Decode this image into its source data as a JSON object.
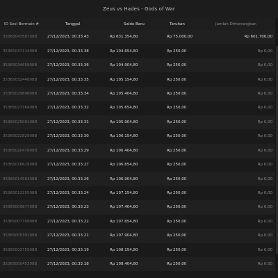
{
  "window": {
    "title": "Zeus vs Hades - Gods of War"
  },
  "table": {
    "headers": {
      "id": "ID Sesi Bermain #",
      "date": "Tanggal",
      "saldo": "Saldo Baru",
      "bet": "Taruhan",
      "win": "Jumlah Dimenangkan"
    },
    "rows": [
      {
        "id": "3536504758708B",
        "date": "27/12/2023, 00.33.43",
        "saldo": "Rp 631.354,80",
        "bet": "Rp 75.000,00",
        "win": "Rp 601.700,00",
        "win_positive": true
      },
      {
        "id": "3536503711408B",
        "date": "27/12/2023, 00.33.38",
        "saldo": "Rp 104.654,80",
        "bet": "Rp 250,00",
        "win": "Rp 0,00",
        "win_positive": false
      },
      {
        "id": "3536503465908B",
        "date": "27/12/2023, 00.33.36",
        "saldo": "Rp 104.904,80",
        "bet": "Rp 250,00",
        "win": "Rp 0,00",
        "win_positive": false
      },
      {
        "id": "3536503244808B",
        "date": "27/12/2023, 00.33.35",
        "saldo": "Rp 105.154,80",
        "bet": "Rp 250,00",
        "win": "Rp 0,00",
        "win_positive": false
      },
      {
        "id": "3536502989608B",
        "date": "27/12/2023, 00.33.34",
        "saldo": "Rp 105.404,80",
        "bet": "Rp 250,00",
        "win": "Rp 0,00",
        "win_positive": false
      },
      {
        "id": "3536502736408B",
        "date": "27/12/2023, 00.33.32",
        "saldo": "Rp 105.654,80",
        "bet": "Rp 250,00",
        "win": "Rp 0,00",
        "win_positive": false
      },
      {
        "id": "3536502509108B",
        "date": "27/12/2023, 00.33.31",
        "saldo": "Rp 105.904,80",
        "bet": "Rp 250,00",
        "win": "Rp 0,00",
        "win_positive": false
      },
      {
        "id": "3536502282908B",
        "date": "27/12/2023, 00.33.30",
        "saldo": "Rp 106.154,80",
        "bet": "Rp 250,00",
        "win": "Rp 0,00",
        "win_positive": false
      },
      {
        "id": "3536502047808B",
        "date": "27/12/2023, 00.33.29",
        "saldo": "Rp 106.404,80",
        "bet": "Rp 250,00",
        "win": "Rp 0,00",
        "win_positive": false
      },
      {
        "id": "3536501662908B",
        "date": "27/12/2023, 00.33.27",
        "saldo": "Rp 106.654,80",
        "bet": "Rp 250,00",
        "win": "Rp 0,00",
        "win_positive": false
      },
      {
        "id": "3536501456308B",
        "date": "27/12/2023, 00.33.26",
        "saldo": "Rp 106.904,80",
        "bet": "Rp 250,00",
        "win": "Rp 0,00",
        "win_positive": false
      },
      {
        "id": "3536501225508B",
        "date": "27/12/2023, 00.33.24",
        "saldo": "Rp 107.154,80",
        "bet": "Rp 250,00",
        "win": "Rp 0,00",
        "win_positive": false
      },
      {
        "id": "3536500987708B",
        "date": "27/12/2023, 00.33.23",
        "saldo": "Rp 107.404,80",
        "bet": "Rp 250,00",
        "win": "Rp 0,00",
        "win_positive": false
      },
      {
        "id": "3536500770908B",
        "date": "27/12/2023, 00.33.22",
        "saldo": "Rp 107.654,80",
        "bet": "Rp 250,00",
        "win": "Rp 0,00",
        "win_positive": false
      },
      {
        "id": "3536500539108B",
        "date": "27/12/2023, 00.33.21",
        "saldo": "Rp 107.904,80",
        "bet": "Rp 250,00",
        "win": "Rp 0,00",
        "win_positive": false
      },
      {
        "id": "3536500275508B",
        "date": "27/12/2023, 00.33.19",
        "saldo": "Rp 108.154,80",
        "bet": "Rp 250,00",
        "win": "Rp 0,00",
        "win_positive": false
      },
      {
        "id": "3536500045308B",
        "date": "27/12/2023, 00.33.18",
        "saldo": "Rp 108.404,80",
        "bet": "Rp 250,00",
        "win": "Rp 0,00",
        "win_positive": false
      }
    ]
  }
}
